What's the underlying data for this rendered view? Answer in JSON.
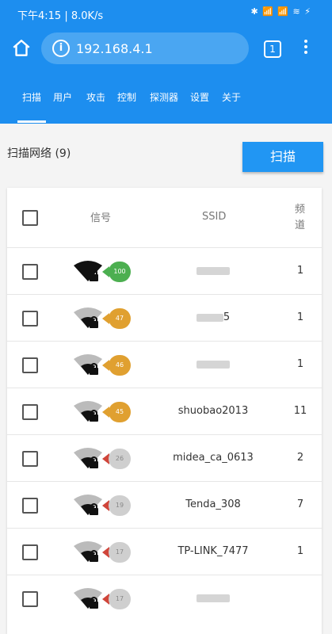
{
  "status": {
    "time_info": "下午4:15 | 8.0K/s",
    "right_icons": "✱ 📶 📶 ≋ ⚡"
  },
  "browser": {
    "url": "192.168.4.1",
    "tab_count": "1"
  },
  "nav": {
    "items": [
      {
        "label": "扫描"
      },
      {
        "label": "用户"
      },
      {
        "label": "攻击"
      },
      {
        "label": "控制"
      },
      {
        "label": "探测器"
      },
      {
        "label": "设置"
      },
      {
        "label": "关于"
      }
    ]
  },
  "section": {
    "title": "扫描网络 (9)",
    "scan_button": "扫描"
  },
  "table": {
    "headers": {
      "signal": "信号",
      "ssid": "SSID",
      "channel": "频\n道"
    },
    "rows": [
      {
        "ssid": "",
        "channel": "1",
        "signal": "100",
        "badge_color": "#4caf50",
        "pointer_color": "#4caf50"
      },
      {
        "ssid": "5",
        "channel": "1",
        "signal": "47",
        "badge_color": "#e0a030",
        "pointer_color": "#e0a030"
      },
      {
        "ssid": "",
        "channel": "1",
        "signal": "46",
        "badge_color": "#e0a030",
        "pointer_color": "#e0a030"
      },
      {
        "ssid": "shuobao2013",
        "channel": "11",
        "signal": "45",
        "badge_color": "#e0a030",
        "pointer_color": "#e0a030"
      },
      {
        "ssid": "midea_ca_0613",
        "channel": "2",
        "signal": "26",
        "badge_color": "#cfcfcf",
        "pointer_color": "#d0453a"
      },
      {
        "ssid": "Tenda_308",
        "channel": "7",
        "signal": "19",
        "badge_color": "#cfcfcf",
        "pointer_color": "#d0453a"
      },
      {
        "ssid": "TP-LINK_7477",
        "channel": "1",
        "signal": "17",
        "badge_color": "#cfcfcf",
        "pointer_color": "#d0453a"
      },
      {
        "ssid": "",
        "channel": "",
        "signal": "17",
        "badge_color": "#cfcfcf",
        "pointer_color": "#d0453a"
      }
    ]
  },
  "colors": {
    "primary": "#1d8eef",
    "button": "#2196f3"
  }
}
